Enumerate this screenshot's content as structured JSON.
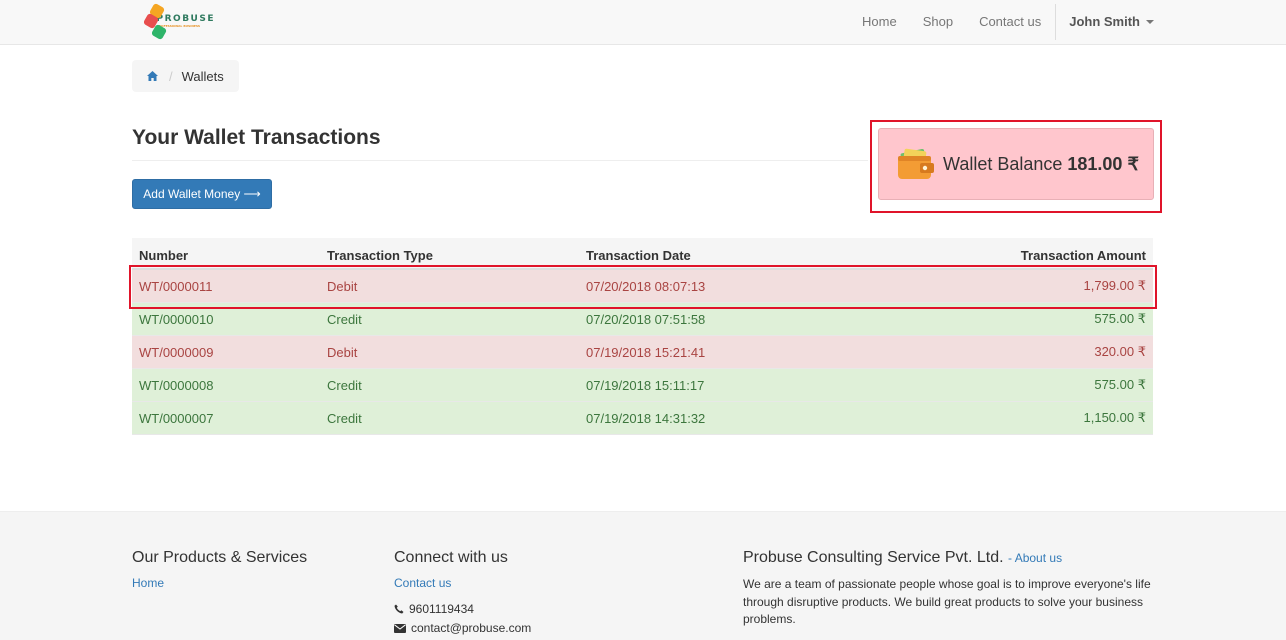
{
  "brand": {
    "name": "PROBUSE",
    "tagline": "PROFESSIONAL BUSINESS"
  },
  "nav": {
    "links": [
      "Home",
      "Shop",
      "Contact us"
    ],
    "user": "John Smith"
  },
  "breadcrumb": {
    "current": "Wallets"
  },
  "page": {
    "title": "Your Wallet Transactions",
    "add_button": "Add Wallet Money ⟶"
  },
  "wallet": {
    "label": "Wallet Balance",
    "value": "181.00 ₹"
  },
  "table": {
    "headers": [
      "Number",
      "Transaction Type",
      "Transaction Date",
      "Transaction Amount"
    ],
    "rows": [
      {
        "number": "WT/0000011",
        "type": "Debit",
        "date": "07/20/2018 08:07:13",
        "amount": "1,799.00 ₹"
      },
      {
        "number": "WT/0000010",
        "type": "Credit",
        "date": "07/20/2018 07:51:58",
        "amount": "575.00 ₹"
      },
      {
        "number": "WT/0000009",
        "type": "Debit",
        "date": "07/19/2018 15:21:41",
        "amount": "320.00 ₹"
      },
      {
        "number": "WT/0000008",
        "type": "Credit",
        "date": "07/19/2018 15:11:17",
        "amount": "575.00 ₹"
      },
      {
        "number": "WT/0000007",
        "type": "Credit",
        "date": "07/19/2018 14:31:32",
        "amount": "1,150.00 ₹"
      }
    ]
  },
  "footer": {
    "products": {
      "title": "Our Products & Services",
      "links": [
        "Home"
      ]
    },
    "connect": {
      "title": "Connect with us",
      "link": "Contact us",
      "phone": "9601119434",
      "email": "contact@probuse.com"
    },
    "company": {
      "title": "Probuse Consulting Service Pvt. Ltd.",
      "about_link": "- About us",
      "text": "We are a team of passionate people whose goal is to improve everyone's life through disruptive products. We build great products to solve your business problems."
    }
  },
  "colors": {
    "accent": "#337ab7",
    "debit_bg": "#f2dede",
    "credit_bg": "#dff0d8",
    "highlight": "#e0142a",
    "balance_bg": "#ffc6cd"
  }
}
